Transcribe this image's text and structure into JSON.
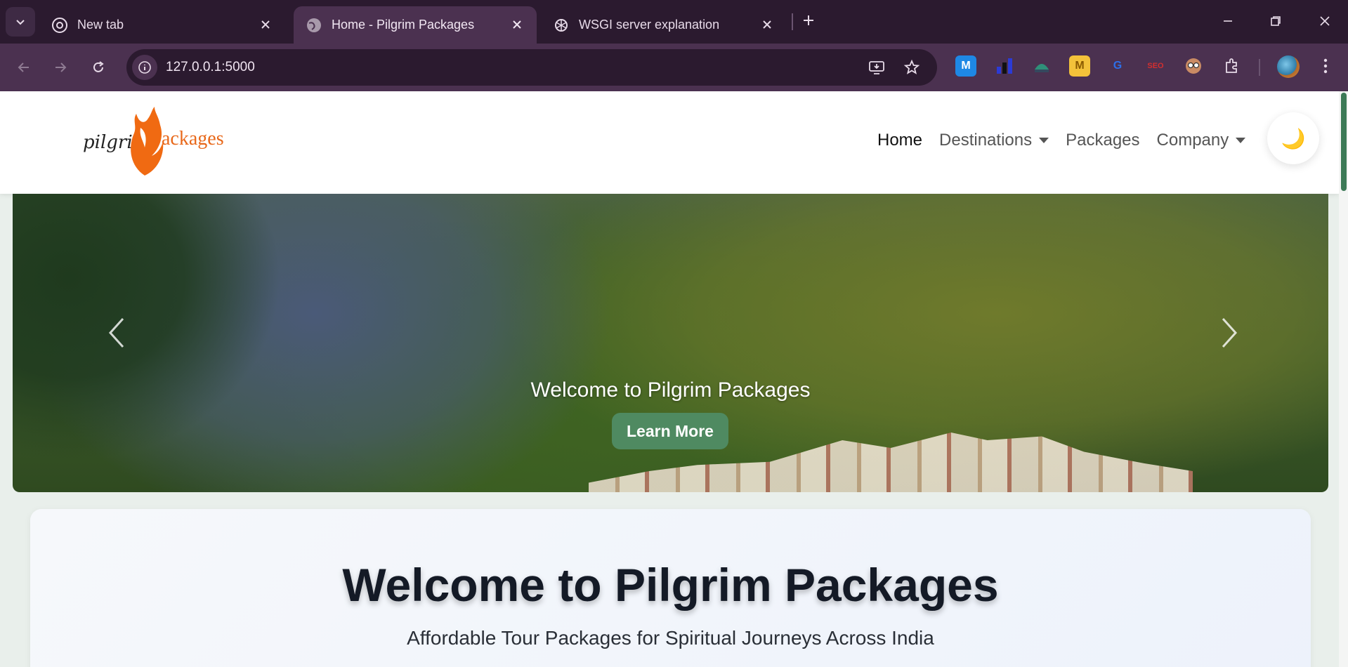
{
  "browser": {
    "tabs": [
      {
        "title": "New tab",
        "icon": "chrome-icon"
      },
      {
        "title": "Home - Pilgrim Packages",
        "icon": "globe-icon",
        "active": true
      },
      {
        "title": "WSGI server explanation",
        "icon": "openai-icon"
      }
    ],
    "url": "127.0.0.1:5000",
    "extensions": [
      {
        "name": "M",
        "color": "#1e88e5"
      },
      {
        "name": "bar-chart",
        "color": "#2b3bd6"
      },
      {
        "name": "owl",
        "color": "#2f8f79"
      },
      {
        "name": "M",
        "color": "#f3c23a"
      },
      {
        "name": "G",
        "color": "#2d6fe8"
      },
      {
        "name": "SEO",
        "color": "#d32f2f"
      },
      {
        "name": "glasses",
        "color": "#c98b64"
      }
    ]
  },
  "site": {
    "logo": {
      "script": "pilgri",
      "rest": "ackages"
    },
    "nav": {
      "home": "Home",
      "destinations": "Destinations",
      "packages": "Packages",
      "company": "Company"
    },
    "theme_toggle": "🌙",
    "hero": {
      "title": "Welcome to Pilgrim Packages",
      "button": "Learn More"
    },
    "welcome": {
      "title": "Welcome to Pilgrim Packages",
      "subtitle": "Affordable Tour Packages for Spiritual Journeys Across India"
    }
  },
  "colors": {
    "chrome_bg": "#2b1a2f",
    "toolbar_bg": "#4b3150",
    "accent_orange": "#e8681a",
    "hero_button": "#4f8a61"
  }
}
